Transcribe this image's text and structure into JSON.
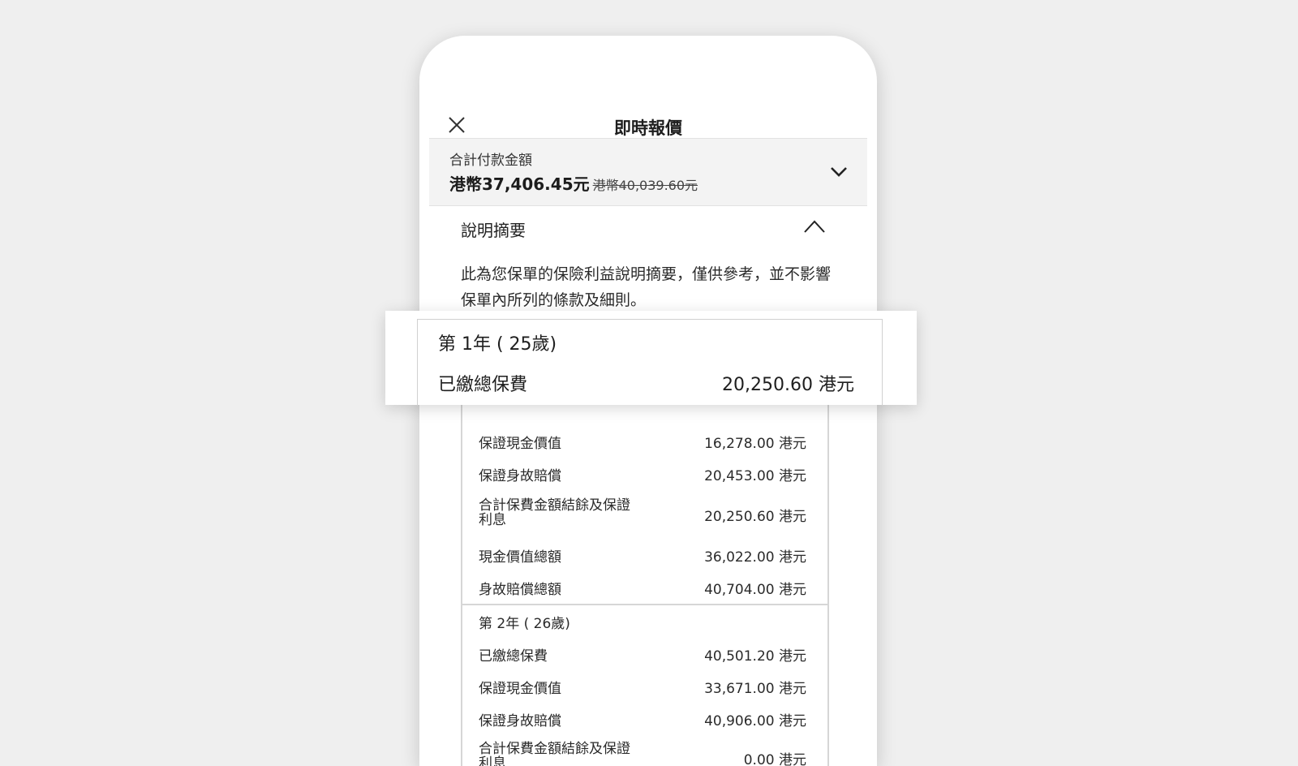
{
  "header": {
    "title": "即時報價"
  },
  "total": {
    "label": "合計付款金額",
    "amount": "港幣37,406.45元",
    "original": "港幣40,039.60元"
  },
  "summary": {
    "title": "說明摘要",
    "description": "此為您保單的保險利益說明摘要，僅供參考，並不影響保單內所列的條款及細則。"
  },
  "popup": {
    "year": "第 1年 ( 25歲)",
    "label": "已繳總保費",
    "value": "20,250.60 港元"
  },
  "table": {
    "year1_rows": [
      {
        "label": "保證現金價值",
        "value": "16,278.00 港元"
      },
      {
        "label": "保證身故賠償",
        "value": "20,453.00 港元"
      },
      {
        "label": "合計保費金額結餘及保證利息",
        "value": "20,250.60 港元"
      },
      {
        "label": "現金價值總額",
        "value": "36,022.00 港元"
      },
      {
        "label": "身故賠償總額",
        "value": "40,704.00 港元"
      }
    ],
    "year2_title": "第 2年 ( 26歲)",
    "year2_rows": [
      {
        "label": "已繳總保費",
        "value": "40,501.20 港元"
      },
      {
        "label": "保證現金價值",
        "value": "33,671.00 港元"
      },
      {
        "label": "保證身故賠償",
        "value": "40,906.00 港元"
      },
      {
        "label": "合計保費金額結餘及保證利息",
        "value": "0.00 港元"
      }
    ]
  }
}
